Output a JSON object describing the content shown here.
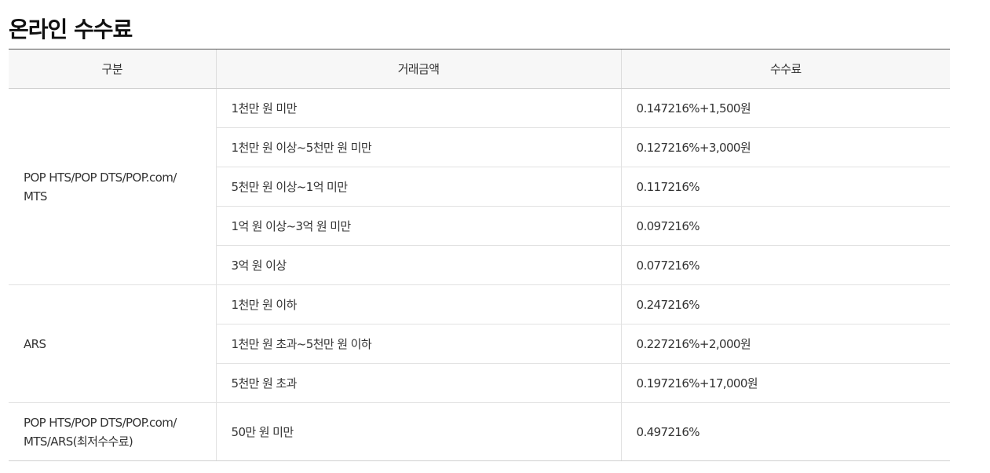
{
  "title": "온라인 수수료",
  "table": {
    "headers": [
      "구분",
      "거래금액",
      "수수료"
    ],
    "groups": [
      {
        "name_lines": [
          "POP HTS/POP DTS/POP.com/",
          "MTS"
        ],
        "rows": [
          {
            "amount": "1천만 원 미만",
            "fee": "0.147216%+1,500원"
          },
          {
            "amount": "1천만 원 이상~5천만 원 미만",
            "fee": "0.127216%+3,000원"
          },
          {
            "amount": "5천만 원 이상~1억 미만",
            "fee": "0.117216%"
          },
          {
            "amount": "1억 원 이상~3억 원 미만",
            "fee": "0.097216%"
          },
          {
            "amount": "3억 원 이상",
            "fee": "0.077216%"
          }
        ]
      },
      {
        "name_lines": [
          "ARS"
        ],
        "rows": [
          {
            "amount": "1천만 원 이하",
            "fee": "0.247216%"
          },
          {
            "amount": "1천만 원 초과~5천만 원 이하",
            "fee": "0.227216%+2,000원"
          },
          {
            "amount": "5천만 원 초과",
            "fee": "0.197216%+17,000원"
          }
        ]
      },
      {
        "name_lines": [
          "POP HTS/POP DTS/POP.com/",
          "MTS/ARS(최저수수료)"
        ],
        "rows": [
          {
            "amount": "50만 원 미만",
            "fee": "0.497216%"
          }
        ]
      }
    ]
  }
}
